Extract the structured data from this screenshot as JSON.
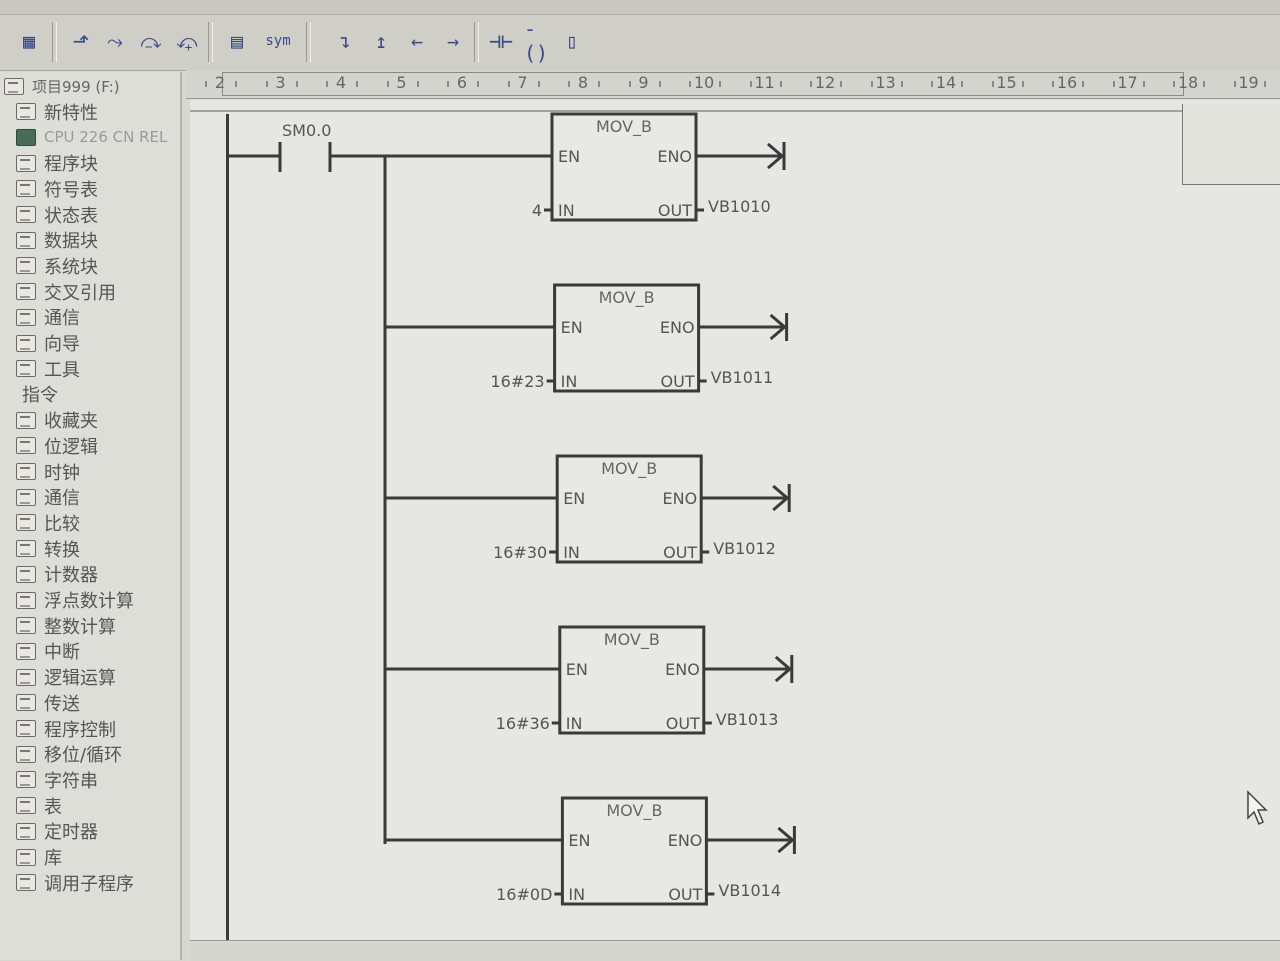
{
  "toolbar": {
    "buttons": [
      {
        "name": "grid-icon",
        "glyph": "▦"
      },
      {
        "name": "arrow-up-icon",
        "glyph": "⬏"
      },
      {
        "name": "step-icon",
        "glyph": "⤳"
      },
      {
        "name": "step-over-icon",
        "glyph": "⤼"
      },
      {
        "name": "close-step-icon",
        "glyph": "⤽"
      },
      {
        "name": "network-icon",
        "glyph": "▤"
      },
      {
        "name": "symbol-icon",
        "glyph": "sym"
      },
      {
        "name": "line-down-icon",
        "glyph": "↴"
      },
      {
        "name": "line-up-icon",
        "glyph": "↥"
      },
      {
        "name": "line-left-icon",
        "glyph": "←"
      },
      {
        "name": "line-right-icon",
        "glyph": "→"
      },
      {
        "name": "contact-icon",
        "glyph": "⊣⊢"
      },
      {
        "name": "coil-icon",
        "glyph": "-()"
      },
      {
        "name": "box-icon",
        "glyph": "▯"
      }
    ]
  },
  "sidebar": {
    "items": [
      {
        "label": "项目999 (F:)",
        "kind": "root"
      },
      {
        "label": "新特性",
        "kind": "item"
      },
      {
        "label": "CPU 226 CN REL",
        "kind": "cpu"
      },
      {
        "label": "程序块",
        "kind": "item"
      },
      {
        "label": "符号表",
        "kind": "item"
      },
      {
        "label": "状态表",
        "kind": "item"
      },
      {
        "label": "数据块",
        "kind": "item"
      },
      {
        "label": "系统块",
        "kind": "item"
      },
      {
        "label": "交叉引用",
        "kind": "item"
      },
      {
        "label": "通信",
        "kind": "item"
      },
      {
        "label": "向导",
        "kind": "item"
      },
      {
        "label": "工具",
        "kind": "item"
      },
      {
        "label": "指令",
        "kind": "cat"
      },
      {
        "label": "收藏夹",
        "kind": "item"
      },
      {
        "label": "位逻辑",
        "kind": "item"
      },
      {
        "label": "时钟",
        "kind": "item"
      },
      {
        "label": "通信",
        "kind": "item"
      },
      {
        "label": "比较",
        "kind": "item"
      },
      {
        "label": "转换",
        "kind": "item"
      },
      {
        "label": "计数器",
        "kind": "item"
      },
      {
        "label": "浮点数计算",
        "kind": "item"
      },
      {
        "label": "整数计算",
        "kind": "item"
      },
      {
        "label": "中断",
        "kind": "item"
      },
      {
        "label": "逻辑运算",
        "kind": "item"
      },
      {
        "label": "传送",
        "kind": "item"
      },
      {
        "label": "程序控制",
        "kind": "item"
      },
      {
        "label": "移位/循环",
        "kind": "item"
      },
      {
        "label": "字符串",
        "kind": "item"
      },
      {
        "label": "表",
        "kind": "item"
      },
      {
        "label": "定时器",
        "kind": "item"
      },
      {
        "label": "库",
        "kind": "item"
      },
      {
        "label": "调用子程序",
        "kind": "item"
      }
    ]
  },
  "ruler": {
    "labels": [
      "2",
      "3",
      "4",
      "5",
      "6",
      "7",
      "8",
      "9",
      "10",
      "11",
      "12",
      "13",
      "14",
      "15",
      "16",
      "17",
      "18",
      "19",
      "2"
    ]
  },
  "ladder": {
    "contact_label": "SM0.0",
    "blocks": [
      {
        "title": "MOV_B",
        "en": "EN",
        "eno": "ENO",
        "in_pin": "IN",
        "out_pin": "OUT",
        "in_value": "4",
        "out_value": "VB1010"
      },
      {
        "title": "MOV_B",
        "en": "EN",
        "eno": "ENO",
        "in_pin": "IN",
        "out_pin": "OUT",
        "in_value": "16#23",
        "out_value": "VB1011"
      },
      {
        "title": "MOV_B",
        "en": "EN",
        "eno": "ENO",
        "in_pin": "IN",
        "out_pin": "OUT",
        "in_value": "16#30",
        "out_value": "VB1012"
      },
      {
        "title": "MOV_B",
        "en": "EN",
        "eno": "ENO",
        "in_pin": "IN",
        "out_pin": "OUT",
        "in_value": "16#36",
        "out_value": "VB1013"
      },
      {
        "title": "MOV_B",
        "en": "EN",
        "eno": "ENO",
        "in_pin": "IN",
        "out_pin": "OUT",
        "in_value": "16#0D",
        "out_value": "VB1014"
      }
    ]
  }
}
